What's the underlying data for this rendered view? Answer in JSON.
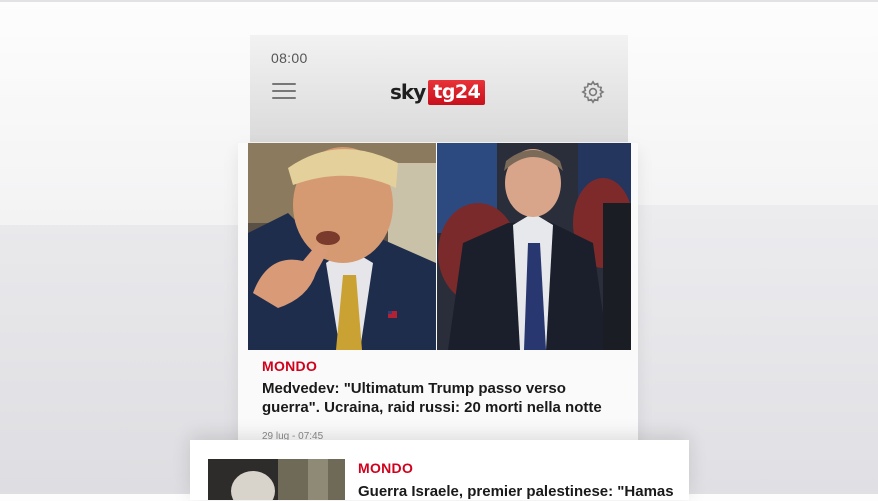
{
  "status_bar": {
    "time": "08:00"
  },
  "header": {
    "logo_sky": "sky",
    "logo_tg": "tg24",
    "menu_icon": "hamburger-menu-icon",
    "settings_icon": "gear-icon"
  },
  "colors": {
    "accent": "#d0021b",
    "logo_red": "#c8101c",
    "header_bg": "#e4e4e4"
  },
  "articles": [
    {
      "category": "MONDO",
      "title": "Medvedev: \"Ultimatum Trump passo verso guerra\". Ucraina, raid russi: 20 morti nella notte",
      "date": "29 lug - 07:45"
    },
    {
      "category": "MONDO",
      "title": "Guerra Israele, premier palestinese: \"Hamas"
    }
  ]
}
